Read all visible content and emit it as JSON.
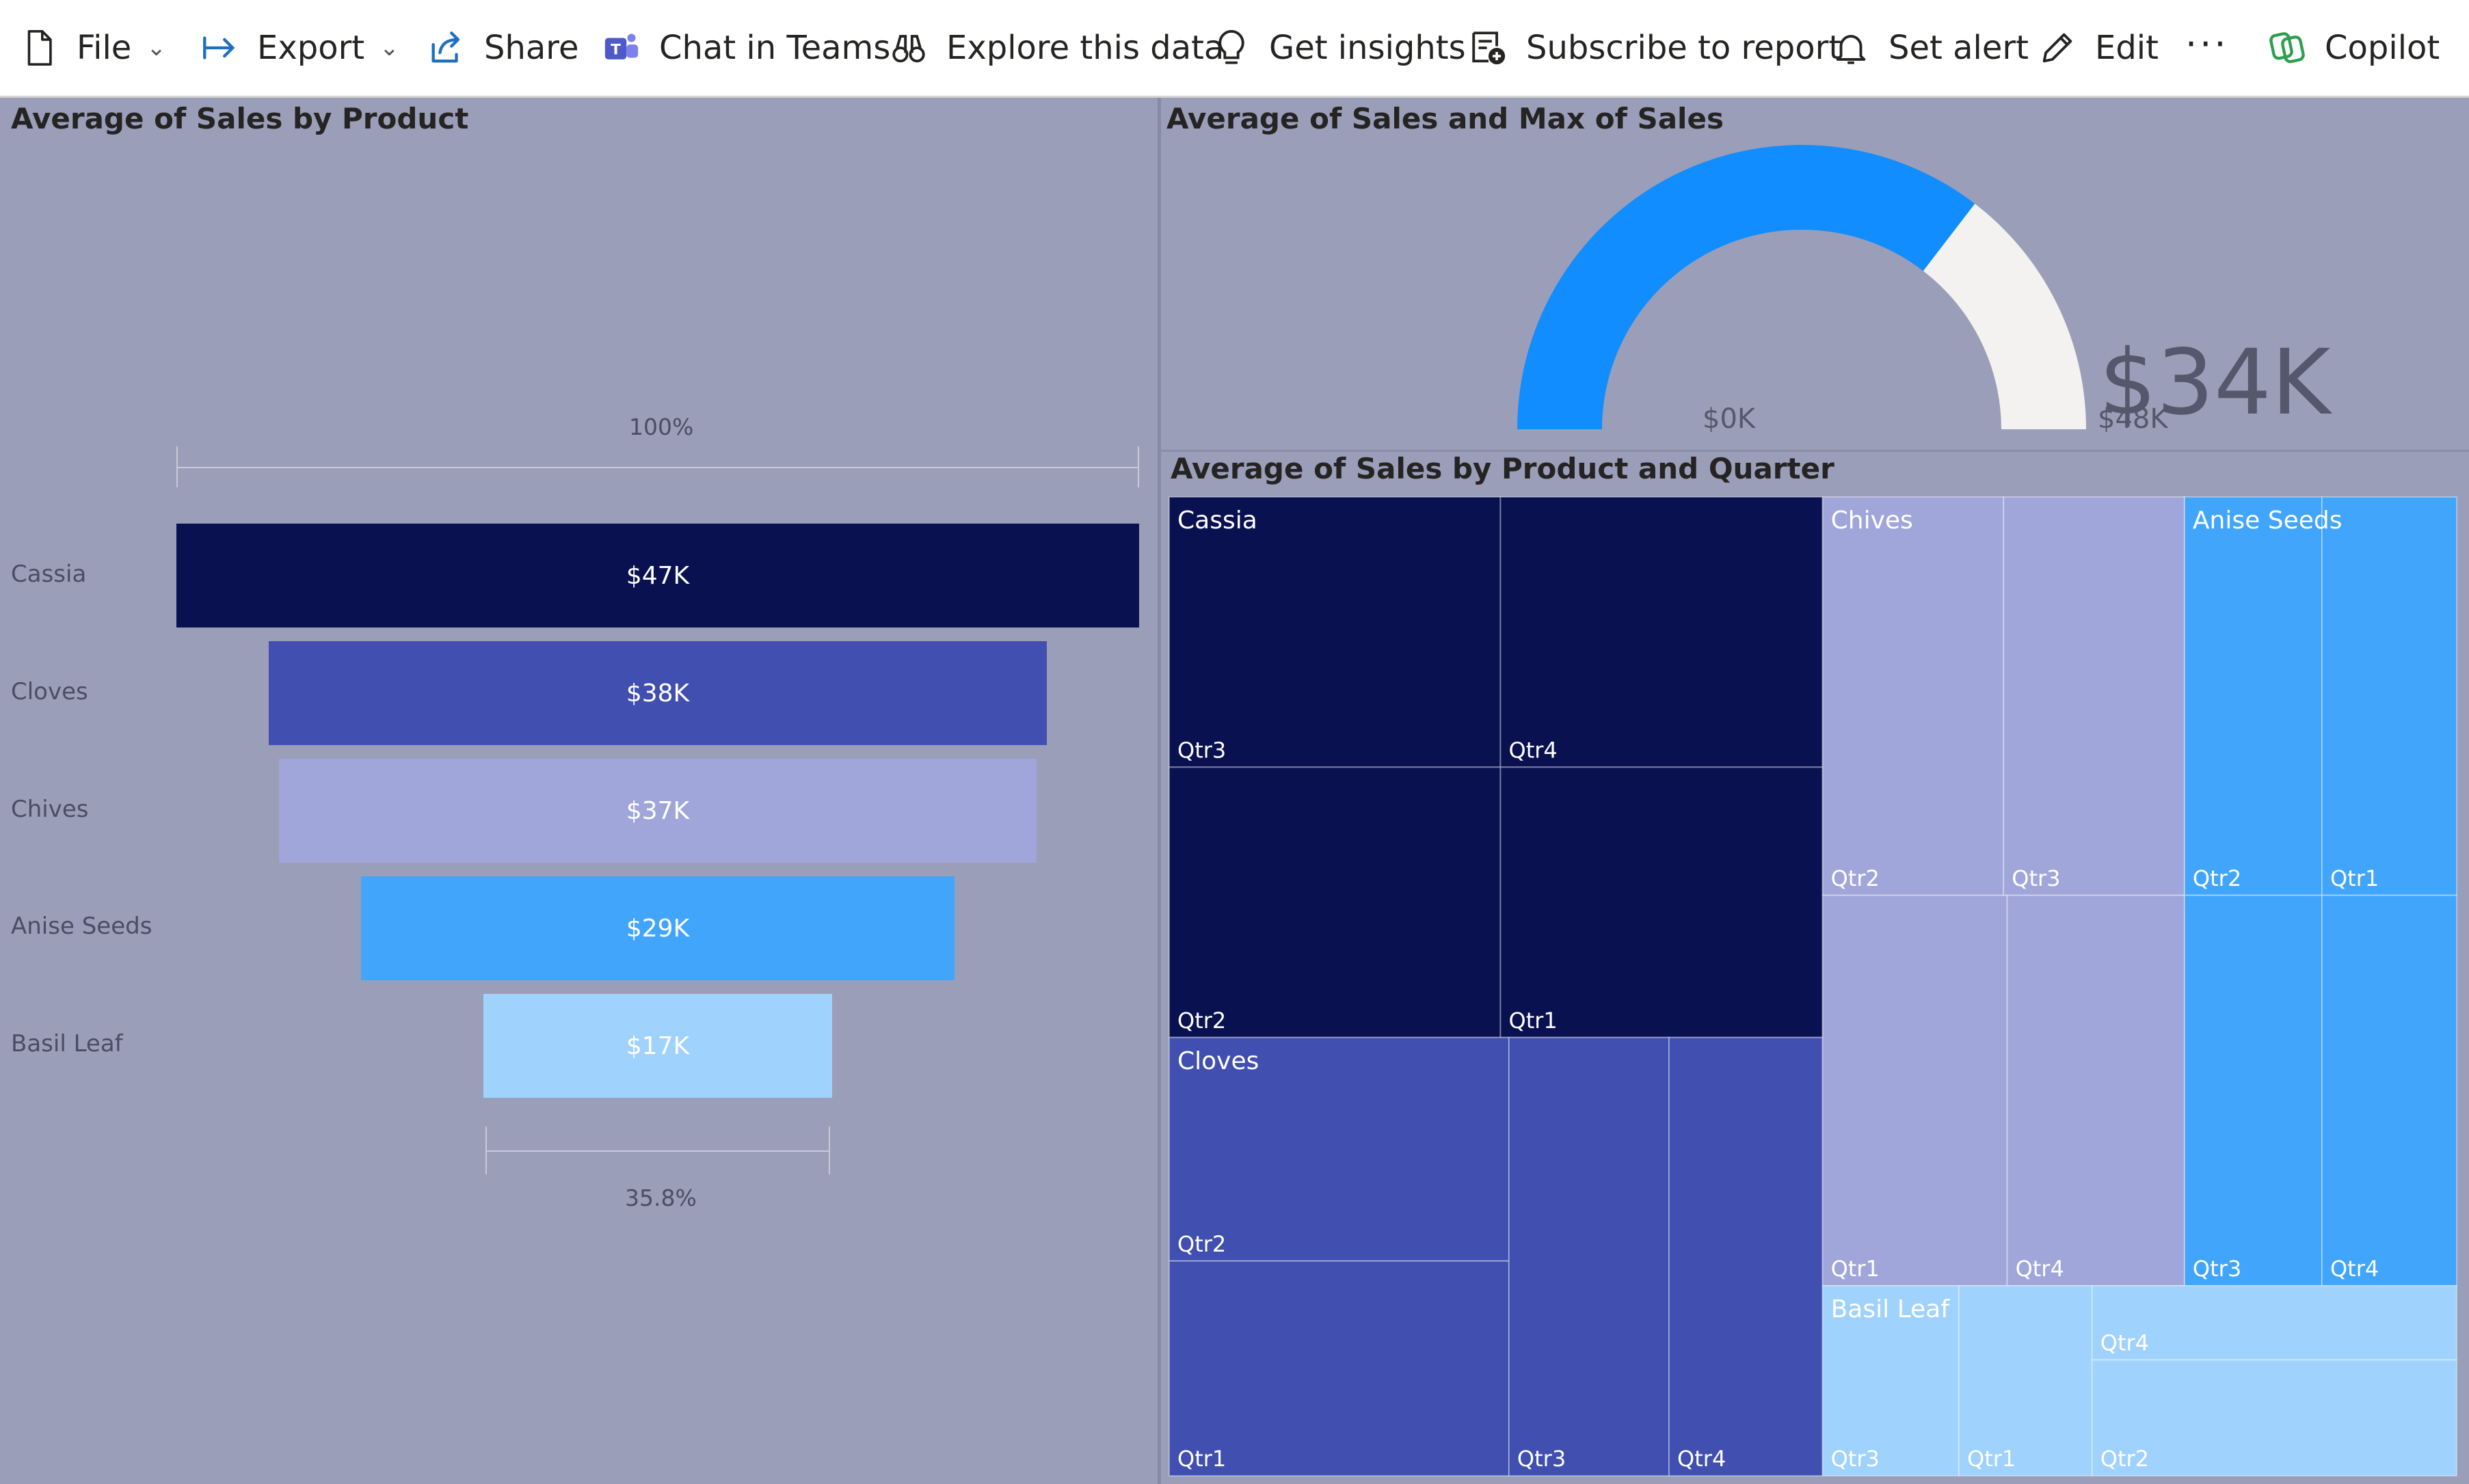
{
  "toolbar": {
    "file": "File",
    "export": "Export",
    "share": "Share",
    "chat": "Chat in Teams",
    "explore": "Explore this data",
    "insights": "Get insights",
    "subscribe": "Subscribe to report",
    "alert": "Set alert",
    "edit": "Edit",
    "more": "···",
    "copilot": "Copilot"
  },
  "colors": {
    "background": "#9a9eb8",
    "dark_navy": "#0a1150",
    "indigo": "#4150b0",
    "lavender": "#a1a6da",
    "bright_blue": "#42a5fc",
    "pale_blue": "#a0d2fe",
    "gauge_fill": "#118dff",
    "gauge_track": "#f3f2f1"
  },
  "icons": {
    "file": "document-icon",
    "export": "arrow-to-bar-icon",
    "share": "share-icon",
    "chat": "teams-icon",
    "explore": "binoculars-icon",
    "insights": "lightbulb-icon",
    "subscribe": "subscribe-icon",
    "alert": "bell-icon",
    "edit": "pencil-icon",
    "copilot": "copilot-icon"
  },
  "funnel": {
    "title": "Average of Sales by Product",
    "top_pct": "100%",
    "bottom_pct": "35.8%",
    "labels": [
      "Cassia",
      "Cloves",
      "Chives",
      "Anise Seeds",
      "Basil Leaf"
    ],
    "value_labels": [
      "$47K",
      "$38K",
      "$37K",
      "$29K",
      "$17K"
    ]
  },
  "gauge": {
    "title": "Average of Sales and Max of Sales",
    "value_label": "$34K",
    "min_label": "$0K",
    "max_label": "$48K"
  },
  "treemap": {
    "title": "Average of Sales by Product and Quarter"
  },
  "chart_data": [
    {
      "type": "bar",
      "subtype": "funnel",
      "title": "Average of Sales by Product",
      "categories": [
        "Cassia",
        "Cloves",
        "Chives",
        "Anise Seeds",
        "Basil Leaf"
      ],
      "values": [
        47,
        38,
        37,
        29,
        17
      ],
      "value_labels": [
        "$47K",
        "$38K",
        "$37K",
        "$29K",
        "$17K"
      ],
      "colors": [
        "#0a1150",
        "#4150b0",
        "#a1a6da",
        "#42a5fc",
        "#a0d2fe"
      ],
      "annotations": [
        "100%",
        "35.8%"
      ]
    },
    {
      "type": "gauge",
      "title": "Average of Sales and Max of Sales",
      "value": 34,
      "min": 0,
      "max": 48,
      "value_label": "$34K",
      "min_label": "$0K",
      "max_label": "$48K"
    },
    {
      "type": "treemap",
      "title": "Average of Sales by Product and Quarter",
      "groups": [
        {
          "name": "Cassia",
          "color": "#0a1150",
          "children": [
            "Qtr3",
            "Qtr4",
            "Qtr2",
            "Qtr1"
          ]
        },
        {
          "name": "Cloves",
          "color": "#4150b0",
          "children": [
            "Qtr2",
            "Qtr1",
            "Qtr3",
            "Qtr4"
          ]
        },
        {
          "name": "Chives",
          "color": "#a1a6da",
          "children": [
            "Qtr2",
            "Qtr3",
            "Qtr1",
            "Qtr4"
          ]
        },
        {
          "name": "Anise Seeds",
          "color": "#42a5fc",
          "children": [
            "Qtr2",
            "Qtr1",
            "Qtr3",
            "Qtr4"
          ]
        },
        {
          "name": "Basil Leaf",
          "color": "#a0d2fe",
          "children": [
            "Qtr3",
            "Qtr1",
            "Qtr4",
            "Qtr2"
          ]
        }
      ]
    }
  ]
}
